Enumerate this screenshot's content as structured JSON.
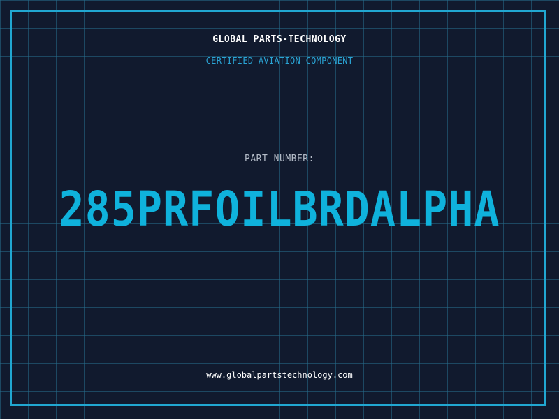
{
  "header": {
    "brand": "GLOBAL PARTS-TECHNOLOGY",
    "tagline": "CERTIFIED AVIATION COMPONENT"
  },
  "main": {
    "label": "PART NUMBER:",
    "part_number": "285PRFOILBRDALPHA"
  },
  "footer": {
    "url": "www.globalpartstechnology.com"
  },
  "colors": {
    "background": "#111a2e",
    "grid": "#266e8c",
    "accent": "#0fb2dc",
    "frame": "#21a7d1"
  }
}
